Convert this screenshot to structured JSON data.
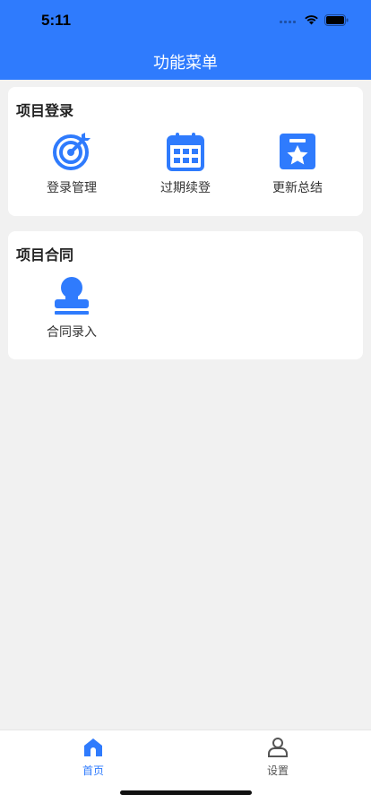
{
  "status_bar": {
    "time": "5:11"
  },
  "header": {
    "title": "功能菜单"
  },
  "sections": [
    {
      "title": "项目登录",
      "items": [
        {
          "label": "登录管理",
          "icon": "target-icon"
        },
        {
          "label": "过期续登",
          "icon": "calendar-icon"
        },
        {
          "label": "更新总结",
          "icon": "star-badge-icon"
        }
      ]
    },
    {
      "title": "项目合同",
      "items": [
        {
          "label": "合同录入",
          "icon": "stamp-icon"
        }
      ]
    }
  ],
  "tabbar": {
    "tabs": [
      {
        "label": "首页",
        "icon": "home-icon",
        "active": true
      },
      {
        "label": "设置",
        "icon": "person-icon",
        "active": false
      }
    ]
  },
  "colors": {
    "primary": "#2f7bfd",
    "background": "#f1f1f1",
    "inactive": "#555555"
  }
}
